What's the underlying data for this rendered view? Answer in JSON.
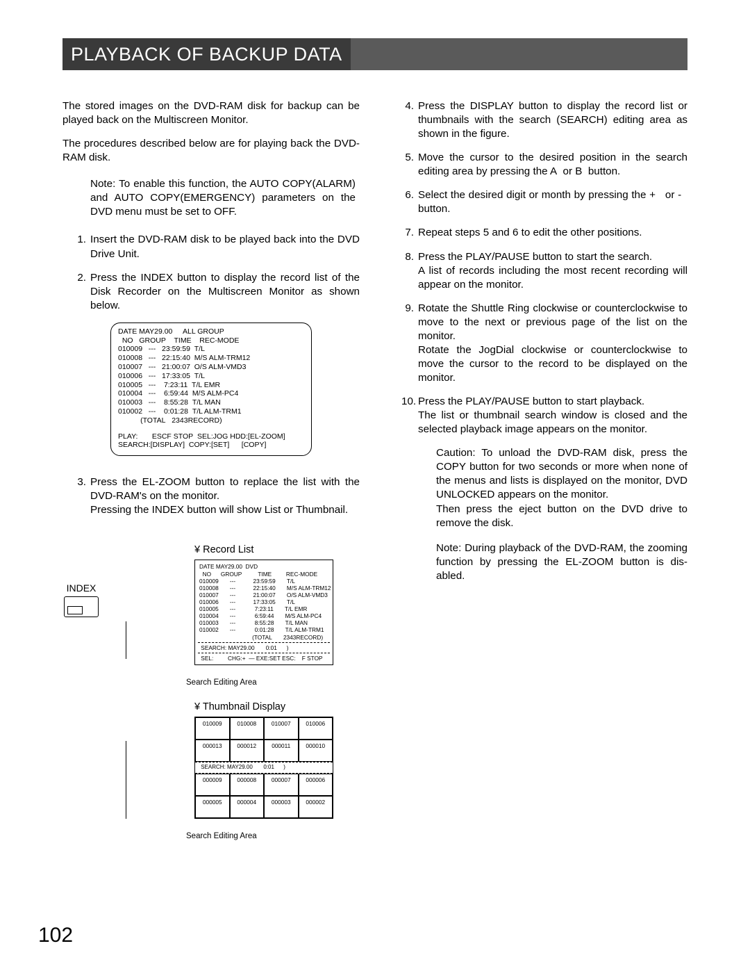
{
  "title": "PLAYBACK OF BACKUP DATA",
  "pagenum": "102",
  "left": {
    "p1": "The stored images on the DVD-RAM disk for backup can be played back on the Multiscreen Monitor.",
    "p2": "The procedures described below are for playing back the DVD-RAM disk.",
    "note": "Note: To enable this function, the AUTO COPY(ALARM) and AUTO COPY(EMERGENCY) parameters on the DVD menu must be set to OFF.",
    "s1n": "1.",
    "s1": "Insert the DVD-RAM disk to be played back into the DVD Drive Unit.",
    "s2n": "2.",
    "s2": "Press the INDEX button to display the record list of the Disk Recorder on the Multiscreen Monitor as shown below.",
    "s3n": "3.",
    "s3a": "Press the EL-ZOOM button to replace the list with the DVD-RAM's on the monitor.",
    "s3b": "Pressing the INDEX button will show List or Thumbnail.",
    "indexLabel": "INDEX",
    "recordListLabel": "¥ Record List",
    "thumbLabel": "¥ Thumbnail Display",
    "sea": "Search Editing Area"
  },
  "right": {
    "s4n": "4.",
    "s4": "Press the DISPLAY button to display the record list or thumbnails with the search (SEARCH) editing area as shown in the figure.",
    "s5n": "5.",
    "s5": "Move the cursor to the desired position in the search editing area by pressing the A  or B  button.",
    "s6n": "6.",
    "s6": "Select the desired digit or month by pressing the +   or -   button.",
    "s7n": "7.",
    "s7": "Repeat steps 5 and 6 to edit the other positions.",
    "s8n": "8.",
    "s8a": "Press the PLAY/PAUSE  button to start the search.",
    "s8b": "A list of records including the most recent recording will appear on the monitor.",
    "s9n": "9.",
    "s9a": "Rotate the Shuttle Ring  clockwise or counterclockwise to move to the next or previous page of the list on the monitor.",
    "s9b": "Rotate the JogDial  clockwise or counterclockwise to move the cursor to the record to be displayed on the monitor.",
    "s10n": "10.",
    "s10a": "Press the PLAY/PAUSE  button to start playback.",
    "s10b": "The list or thumbnail search window is closed and the selected playback image appears on the monitor.",
    "caution": "Caution: To unload the DVD-RAM disk, press the COPY button for two seconds or more when none of the menus and lists is displayed on the monitor, DVD UNLOCKED   appears on the monitor.",
    "caution2": "Then press the eject button on the DVD drive to remove the disk.",
    "note2": "Note: During playback of the DVD-RAM, the zooming function by pressing the EL-ZOOM button is dis-abled."
  },
  "screen1": {
    "l1": "DATE MAY29.00     ALL GROUP",
    "l2": "  NO   GROUP    TIME    REC-MODE",
    "r1": "010009   ---   23:59:59  T/L",
    "r2": "010008   ---   22:15:40  M/S ALM-TRM12",
    "r3": "010007   ---   21:00:07  O/S ALM-VMD3",
    "r4": "010006   ---   17:33:05  T/L",
    "r5": "010005   ---    7:23:11  T/L EMR",
    "r6": "010004   ---    6:59:44  M/S ALM-PC4",
    "r7": "010003   ---    8:55:28  T/L MAN",
    "r8": "010002   ---    0:01:28  T/L ALM-TRM1",
    "tot": "           (TOTAL   2343RECORD)",
    "f1": "PLAY:       ESCF STOP  SEL:JOG HDD:[EL-ZOOM]",
    "f2": "SEARCH:[DISPLAY]  COPY:[SET]      [COPY]"
  },
  "list2": {
    "l1": "DATE MAY29.00  DVD",
    "l2": "  NO      GROUP          TIME         REC-MODE",
    "r1": "010009       ---           23:59:59       T/L",
    "r2": "010008       ---           22:15:40       M/S ALM-TRM12",
    "r3": "010007       ---           21:00:07       O/S ALM-VMD3",
    "r4": "010006       ---           17:33:05       T/L",
    "r5": "010005       ---            7:23:11       T/L EMR",
    "r6": "010004       ---            6:59:44       M/S ALM-PC4",
    "r7": "010003       ---            8:55:28       T/L MAN",
    "r8": "010002       ---            0:01:28       T/L ALM-TRM1",
    "tot": "                                 (TOTAL       2343RECORD)",
    "s1": " SEARCH: MAY29.00       0:01      )",
    "s2": " SEL:         CHG:+  — EXE:SET ESC:    F STOP"
  },
  "thumb": {
    "r1": [
      "010009",
      "010008",
      "010007",
      "010006"
    ],
    "r2": [
      "000013",
      "000012",
      "000011",
      "000010"
    ],
    "s": " SEARCH: MAY29.00       0:01      )",
    "r3": [
      "000009",
      "000008",
      "000007",
      "000006"
    ],
    "r4": [
      "000005",
      "000004",
      "000003",
      "000002"
    ]
  }
}
